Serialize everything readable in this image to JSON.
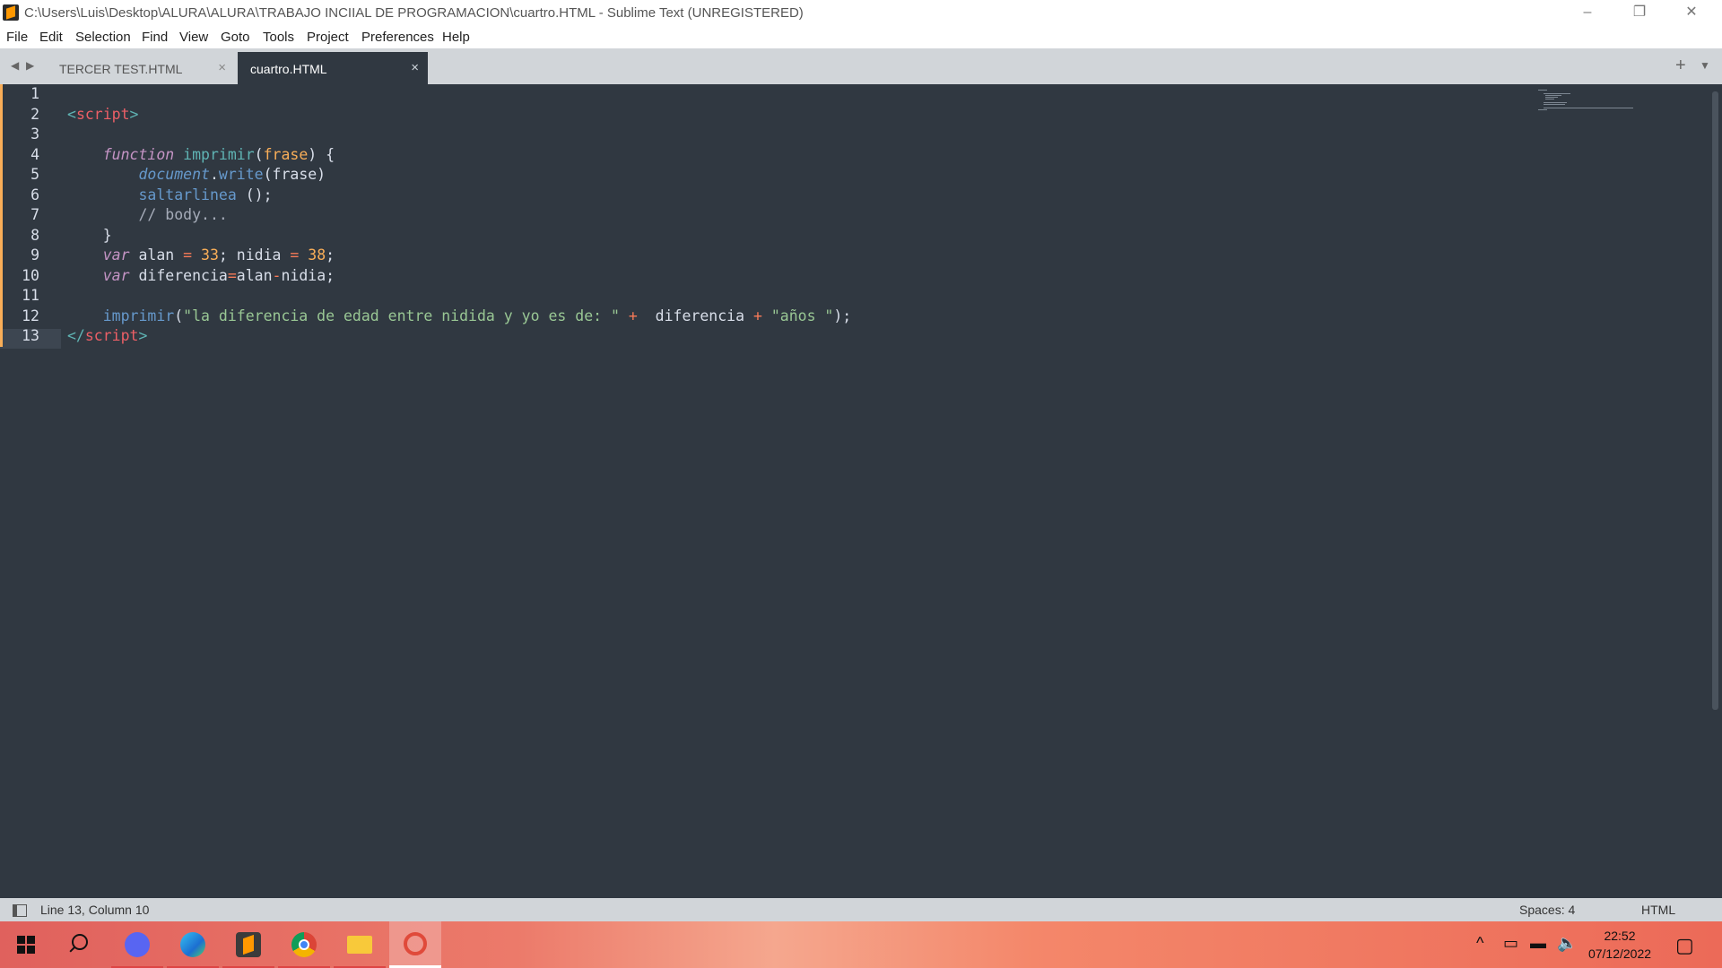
{
  "window": {
    "title": "C:\\Users\\Luis\\Desktop\\ALURA\\ALURA\\TRABAJO INCIIAL DE PROGRAMACION\\cuartro.HTML - Sublime Text (UNREGISTERED)",
    "controls": {
      "minimize": "–",
      "restore": "❐",
      "close": "✕"
    }
  },
  "menu": [
    "File",
    "Edit",
    "Selection",
    "Find",
    "View",
    "Goto",
    "Tools",
    "Project",
    "Preferences",
    "Help"
  ],
  "tabs": [
    {
      "label": "TERCER TEST.HTML",
      "close": "×",
      "active": false
    },
    {
      "label": "cuartro.HTML",
      "close": "×",
      "active": true
    }
  ],
  "tabbar": {
    "nav_left": "◀",
    "nav_right": "▶",
    "new_tab": "+",
    "dropdown": "▼"
  },
  "editor": {
    "line_numbers": [
      "1",
      "2",
      "3",
      "4",
      "5",
      "6",
      "7",
      "8",
      "9",
      "10",
      "11",
      "12",
      "13"
    ],
    "current_line": 13,
    "lines": [
      [],
      [
        {
          "t": "<",
          "c": "pun"
        },
        {
          "t": "script",
          "c": "tag"
        },
        {
          "t": ">",
          "c": "pun"
        }
      ],
      [],
      [
        {
          "t": "    "
        },
        {
          "t": "function",
          "c": "kw"
        },
        {
          "t": " "
        },
        {
          "t": "imprimir",
          "c": "fn"
        },
        {
          "t": "(",
          "c": "plain"
        },
        {
          "t": "frase",
          "c": "par"
        },
        {
          "t": ") {",
          "c": "plain"
        }
      ],
      [
        {
          "t": "        "
        },
        {
          "t": "document",
          "c": "obj"
        },
        {
          "t": ".",
          "c": "plain"
        },
        {
          "t": "write",
          "c": "fnc"
        },
        {
          "t": "(frase)",
          "c": "plain"
        }
      ],
      [
        {
          "t": "        "
        },
        {
          "t": "saltarlinea",
          "c": "fnc"
        },
        {
          "t": " ();",
          "c": "plain"
        }
      ],
      [
        {
          "t": "        "
        },
        {
          "t": "// body...",
          "c": "cmt"
        }
      ],
      [
        {
          "t": "    }",
          "c": "plain"
        }
      ],
      [
        {
          "t": "    "
        },
        {
          "t": "var",
          "c": "kw"
        },
        {
          "t": " alan ",
          "c": "plain"
        },
        {
          "t": "=",
          "c": "op"
        },
        {
          "t": " "
        },
        {
          "t": "33",
          "c": "num"
        },
        {
          "t": "; nidia ",
          "c": "plain"
        },
        {
          "t": "=",
          "c": "op"
        },
        {
          "t": " "
        },
        {
          "t": "38",
          "c": "num"
        },
        {
          "t": ";",
          "c": "plain"
        }
      ],
      [
        {
          "t": "    "
        },
        {
          "t": "var",
          "c": "kw"
        },
        {
          "t": " diferencia",
          "c": "plain"
        },
        {
          "t": "=",
          "c": "op"
        },
        {
          "t": "alan",
          "c": "plain"
        },
        {
          "t": "-",
          "c": "op"
        },
        {
          "t": "nidia;",
          "c": "plain"
        }
      ],
      [],
      [
        {
          "t": "    "
        },
        {
          "t": "imprimir",
          "c": "fnc"
        },
        {
          "t": "(",
          "c": "plain"
        },
        {
          "t": "\"la diferencia de edad entre nidida y yo es de: \"",
          "c": "str"
        },
        {
          "t": " "
        },
        {
          "t": "+",
          "c": "op"
        },
        {
          "t": "  diferencia ",
          "c": "plain"
        },
        {
          "t": "+",
          "c": "op"
        },
        {
          "t": " "
        },
        {
          "t": "\"años \"",
          "c": "str"
        },
        {
          "t": ");",
          "c": "plain"
        }
      ],
      [
        {
          "t": "</",
          "c": "pun"
        },
        {
          "t": "script",
          "c": "tag"
        },
        {
          "t": ">",
          "c": "pun"
        }
      ]
    ]
  },
  "status": {
    "position": "Line 13, Column 10",
    "indent": "Spaces: 4",
    "syntax": "HTML"
  },
  "taskbar": {
    "apps": [
      {
        "name": "start-icon",
        "glyph": "⊞"
      },
      {
        "name": "search-icon",
        "glyph": "⚲"
      },
      {
        "name": "discord-icon",
        "glyph": "◉"
      },
      {
        "name": "edge-icon",
        "glyph": "◐"
      },
      {
        "name": "sublime-icon",
        "glyph": "S"
      },
      {
        "name": "chrome-icon",
        "glyph": "◎"
      },
      {
        "name": "file-explorer-icon",
        "glyph": "▬"
      },
      {
        "name": "snipping-tool-icon",
        "glyph": "✂"
      }
    ],
    "tray": {
      "chevron": "^",
      "network": "▭",
      "battery": "▬",
      "volume": "🔈",
      "notifications": "▢"
    },
    "clock": {
      "time": "22:52",
      "date": "07/12/2022"
    }
  },
  "colors": {
    "editor_bg": "#303841",
    "tab_bg": "#d1d5d9",
    "accent": "#f9ae58"
  }
}
